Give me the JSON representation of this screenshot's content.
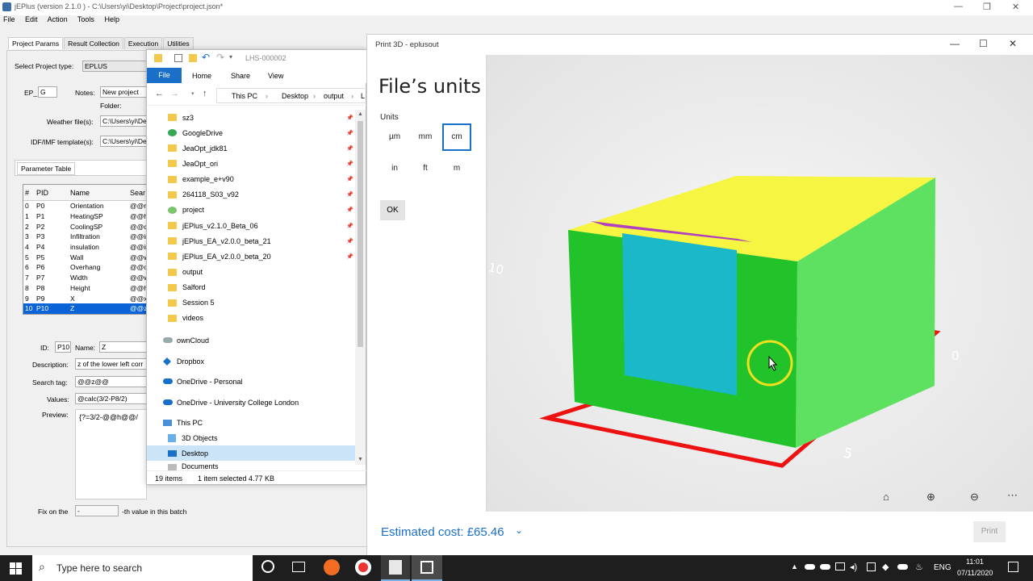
{
  "jeplus": {
    "title": "jEPlus (version 2.1.0 ) - C:\\Users\\yi\\Desktop\\Project\\project.json*",
    "menu": [
      "File",
      "Edit",
      "Action",
      "Tools",
      "Help"
    ],
    "tabs": [
      "Project Params",
      "Result Collection",
      "Execution",
      "Utilities"
    ],
    "project_type_label": "Select Project type:",
    "project_type_value": "EPLUS",
    "ep_label": "EP_",
    "ep_value": "G",
    "notes_label": "Notes:",
    "notes_value": "New project",
    "folder_label": "Folder:",
    "weather_label": "Weather file(s):",
    "weather_value": "C:\\Users\\yi\\De",
    "idf_label": "IDF/IMF template(s):",
    "idf_value": "C:\\Users\\yi\\De",
    "param_table_tab": "Parameter Table",
    "table_headers": [
      "#",
      "PID",
      "Name",
      "Sear"
    ],
    "rows": [
      [
        "0",
        "P0",
        "Orientation",
        "@@n"
      ],
      [
        "1",
        "P1",
        "HeatingSP",
        "@@h"
      ],
      [
        "2",
        "P2",
        "CoolingSP",
        "@@c"
      ],
      [
        "3",
        "P3",
        "Infiltration",
        "@@in"
      ],
      [
        "4",
        "P4",
        "insulation",
        "@@ir"
      ],
      [
        "5",
        "P5",
        "Wall",
        "@@w"
      ],
      [
        "6",
        "P6",
        "Overhang",
        "@@o"
      ],
      [
        "7",
        "P7",
        "Width",
        "@@w"
      ],
      [
        "8",
        "P8",
        "Height",
        "@@h"
      ],
      [
        "9",
        "P9",
        "X",
        "@@x"
      ],
      [
        "10",
        "P10",
        "Z",
        "@@z"
      ]
    ],
    "id_label": "ID:",
    "id_value": "P10",
    "name_label": "Name:",
    "name_value": "Z",
    "desc_label": "Description:",
    "desc_value": "z of the lower left corr",
    "search_tag_label": "Search tag:",
    "search_tag_value": "@@z@@",
    "values_label": "Values:",
    "values_value": "@calc(3/2-P8/2)",
    "preview_label": "Preview:",
    "preview_value": "{?=3/2-@@h@@/",
    "fix_label": "Fix on the",
    "fix_value": "-",
    "fix_suffix": "-th value in this batch"
  },
  "explorer": {
    "title": "LHS-000002",
    "ribbon": [
      "File",
      "Home",
      "Share",
      "View"
    ],
    "path": [
      "This PC",
      "Desktop",
      "output",
      "L"
    ],
    "items": [
      {
        "label": "sz3",
        "pinned": true
      },
      {
        "label": "GoogleDrive",
        "pinned": true
      },
      {
        "label": "JeaOpt_jdk81",
        "pinned": true
      },
      {
        "label": "JeaOpt_ori",
        "pinned": true
      },
      {
        "label": "example_e+v90",
        "pinned": true
      },
      {
        "label": "264118_S03_v92",
        "pinned": true
      },
      {
        "label": "project",
        "pinned": true
      },
      {
        "label": "jEPlus_v2.1.0_Beta_06",
        "pinned": true
      },
      {
        "label": "jEPlus_EA_v2.0.0_beta_21",
        "pinned": true
      },
      {
        "label": "jEPlus_EA_v2.0.0_beta_20",
        "pinned": true
      },
      {
        "label": "output",
        "pinned": false
      },
      {
        "label": "Salford",
        "pinned": false
      },
      {
        "label": "Session 5",
        "pinned": false
      },
      {
        "label": "videos",
        "pinned": false
      }
    ],
    "cloud": [
      "ownCloud",
      "Dropbox",
      "OneDrive - Personal",
      "OneDrive - University College London"
    ],
    "thispc": "This PC",
    "objects3d": "3D Objects",
    "desktop": "Desktop",
    "documents": "Documents",
    "status_items": "19 items",
    "status_selected": "1 item selected  4.77 KB"
  },
  "print3d": {
    "title": "Print 3D - eplusout",
    "heading": "File’s units",
    "units_label": "Units",
    "units_row1": [
      "µm",
      "mm",
      "cm"
    ],
    "units_row2": [
      "in",
      "ft",
      "m"
    ],
    "selected_unit": "cm",
    "ok_label": "OK",
    "cost_label": "Estimated cost: £65.46",
    "print_label": "Print",
    "axis_labels": [
      "10",
      "0",
      "5"
    ],
    "colors": {
      "box": "#22c32a",
      "top": "#f5f542",
      "window": "#1ab8c8",
      "overhang": "#b040c0",
      "base": "#ee1111",
      "accent": "#1a6fc9"
    }
  },
  "taskbar": {
    "search_placeholder": "Type here to search",
    "lang": "ENG",
    "time": "11:01",
    "date": "07/11/2020"
  }
}
